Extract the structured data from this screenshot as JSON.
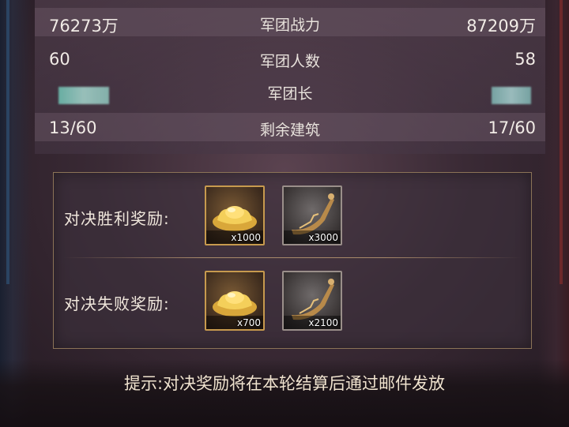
{
  "stats": {
    "rows": [
      {
        "left": "76273万",
        "label": "军团战力",
        "right": "87209万"
      },
      {
        "left": "60",
        "label": "军团人数",
        "right": "58"
      },
      {
        "left": "",
        "label": "军团长",
        "right": ""
      },
      {
        "left": "13/60",
        "label": "剩余建筑",
        "right": "17/60"
      }
    ]
  },
  "rewards": {
    "win": {
      "label": "对决胜利奖励:",
      "items": [
        {
          "icon": "gold-ingot-icon",
          "qty": "x1000"
        },
        {
          "icon": "dragon-boat-icon",
          "qty": "x3000"
        }
      ]
    },
    "lose": {
      "label": "对决失败奖励:",
      "items": [
        {
          "icon": "gold-ingot-icon",
          "qty": "x700"
        },
        {
          "icon": "dragon-boat-icon",
          "qty": "x2100"
        }
      ]
    }
  },
  "tip": "提示:对决奖励将在本轮结算后通过邮件发放",
  "colors": {
    "text": "#f1ebe6",
    "gold_border": "#c79a4e",
    "gray_border": "#9a8f8a",
    "frame": "#8b7357"
  }
}
